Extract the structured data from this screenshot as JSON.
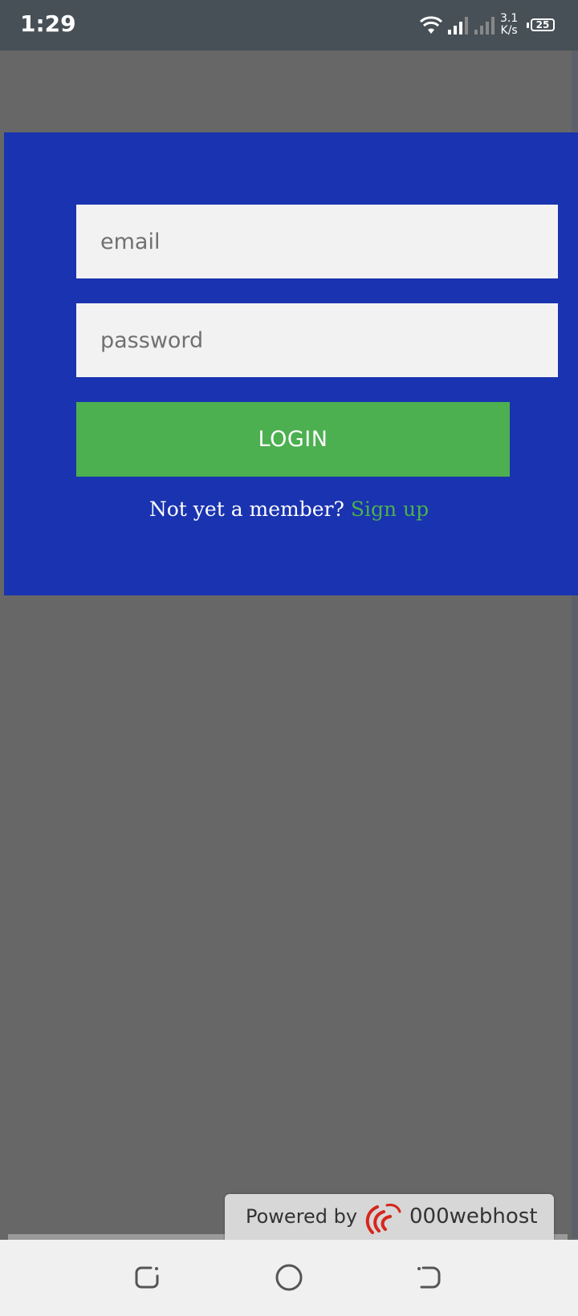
{
  "status_bar": {
    "time": "1:29",
    "net_speed_value": "3.1",
    "net_speed_unit": "K/s",
    "battery": "25"
  },
  "login_form": {
    "email_placeholder": "email",
    "password_placeholder": "password",
    "login_label": "LOGIN",
    "member_prompt": "Not yet a member?",
    "signup_label": "Sign up"
  },
  "powered_badge": {
    "prefix": "Powered by",
    "brand": "000webhost"
  },
  "colors": {
    "panel_bg": "#1a33b0",
    "login_button": "#4caf50",
    "signup_link": "#4caf50",
    "page_bg": "#676767",
    "status_bar_bg": "#475056"
  },
  "icons": [
    "wifi-icon",
    "signal-icon",
    "signal-weak-icon",
    "battery-icon",
    "recent-apps-icon",
    "home-icon",
    "back-icon",
    "brand-logo-icon"
  ]
}
